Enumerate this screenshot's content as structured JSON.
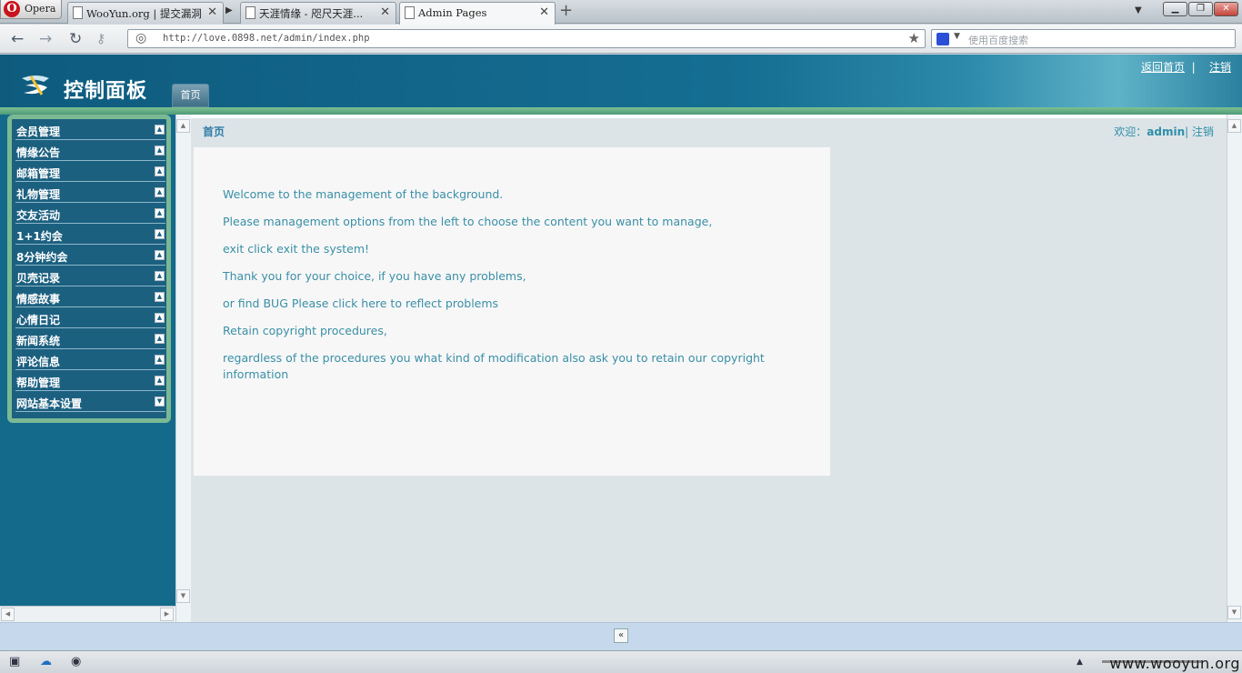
{
  "browser": {
    "menu_label": "Opera",
    "tabs": [
      {
        "title": "WooYun.org | 提交漏洞",
        "active": false
      },
      {
        "title": "天涯情缘 - 咫尺天涯...",
        "active": false
      },
      {
        "title": "Admin Pages",
        "active": true
      }
    ],
    "url": "http://love.0898.net/admin/index.php",
    "search_placeholder": "使用百度搜索",
    "icons": [
      "back-icon",
      "forward-icon",
      "reload-icon",
      "key-icon",
      "globe-icon",
      "star-icon",
      "add-tab-icon",
      "minimize-icon",
      "maximize-icon",
      "close-icon"
    ]
  },
  "header": {
    "title": "控制面板",
    "home_tab": "首页",
    "link_home": "返回首页",
    "link_logout": "注销",
    "colors": {
      "bar": "#156e93",
      "accent": "#7bb994"
    }
  },
  "sidebar": {
    "items": [
      {
        "label": "会员管理"
      },
      {
        "label": "情缘公告"
      },
      {
        "label": "邮箱管理"
      },
      {
        "label": "礼物管理"
      },
      {
        "label": "交友活动"
      },
      {
        "label": "1+1约会"
      },
      {
        "label": "8分钟约会"
      },
      {
        "label": "贝壳记录"
      },
      {
        "label": "情感故事"
      },
      {
        "label": "心情日记"
      },
      {
        "label": "新闻系统"
      },
      {
        "label": "评论信息"
      },
      {
        "label": "帮助管理"
      },
      {
        "label": "网站基本设置"
      }
    ]
  },
  "main": {
    "breadcrumb": "首页",
    "welcome_prefix": "欢迎：",
    "username": "admin",
    "logout": "注销",
    "messages": [
      "Welcome to the management of the background.",
      "Please management options from the left to choose the content you want to manage,",
      "exit click exit the system!",
      "Thank you for your choice, if you have any problems,",
      "or find BUG Please click here to reflect problems",
      "Retain copyright procedures,",
      "regardless of the procedures you what kind of modification also ask you to retain our copyright information"
    ]
  },
  "footer": {
    "collapse_label": "«"
  },
  "watermark": "www.wooyun.org"
}
